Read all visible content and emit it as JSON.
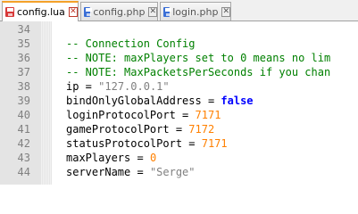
{
  "tabs": [
    {
      "label": "config.lua",
      "active": true,
      "icon": "red-disk-icon"
    },
    {
      "label": "config.php",
      "active": false,
      "icon": "blue-disk-icon"
    },
    {
      "label": "login.php",
      "active": false,
      "icon": "blue-disk-icon"
    }
  ],
  "colors": {
    "comment": "#008000",
    "string": "#808080",
    "number": "#ff8000",
    "keyword": "#0000ff",
    "line_number": "#808080",
    "active_tab_accent": "#f4a12a"
  },
  "lines": [
    {
      "n": "34",
      "tokens": []
    },
    {
      "n": "35",
      "tokens": [
        {
          "t": "comment",
          "v": "-- Connection Config"
        }
      ]
    },
    {
      "n": "36",
      "tokens": [
        {
          "t": "comment",
          "v": "-- NOTE: maxPlayers set to 0 means no lim"
        }
      ]
    },
    {
      "n": "37",
      "tokens": [
        {
          "t": "comment",
          "v": "-- NOTE: MaxPacketsPerSeconds if you chan"
        }
      ]
    },
    {
      "n": "38",
      "tokens": [
        {
          "t": "id",
          "v": "ip"
        },
        {
          "t": "op",
          "v": " = "
        },
        {
          "t": "str",
          "v": "\"127.0.0.1\""
        }
      ]
    },
    {
      "n": "39",
      "tokens": [
        {
          "t": "id",
          "v": "bindOnlyGlobalAddress"
        },
        {
          "t": "op",
          "v": " = "
        },
        {
          "t": "kw",
          "v": "false"
        }
      ]
    },
    {
      "n": "40",
      "tokens": [
        {
          "t": "id",
          "v": "loginProtocolPort"
        },
        {
          "t": "op",
          "v": " = "
        },
        {
          "t": "num",
          "v": "7171"
        }
      ]
    },
    {
      "n": "41",
      "tokens": [
        {
          "t": "id",
          "v": "gameProtocolPort"
        },
        {
          "t": "op",
          "v": " = "
        },
        {
          "t": "num",
          "v": "7172"
        }
      ]
    },
    {
      "n": "42",
      "tokens": [
        {
          "t": "id",
          "v": "statusProtocolPort"
        },
        {
          "t": "op",
          "v": " = "
        },
        {
          "t": "num",
          "v": "7171"
        }
      ]
    },
    {
      "n": "43",
      "tokens": [
        {
          "t": "id",
          "v": "maxPlayers"
        },
        {
          "t": "op",
          "v": " = "
        },
        {
          "t": "num",
          "v": "0"
        }
      ]
    },
    {
      "n": "44",
      "tokens": [
        {
          "t": "id",
          "v": "serverName"
        },
        {
          "t": "op",
          "v": " = "
        },
        {
          "t": "str",
          "v": "\"Serge\""
        }
      ]
    }
  ]
}
